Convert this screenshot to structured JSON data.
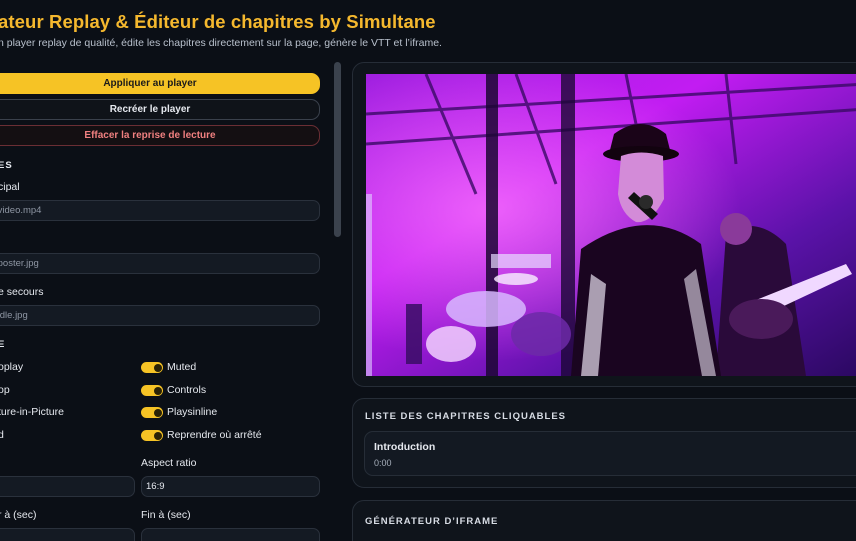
{
  "header": {
    "title": "ateur Replay & Éditeur de chapitres by Simultane",
    "subtitle": "n player replay de qualité, édite les chapitres directement sur la page, génère le VTT et l’iframe."
  },
  "actions": {
    "apply_label": "Appliquer au player",
    "recreate_label": "Recréer le player",
    "clear_label": "Effacer la reprise de lecture"
  },
  "sources": {
    "section_label": "ES",
    "main_label": "cipal",
    "main_placeholder": "/video.mp4",
    "poster_placeholder": "/poster.jpg",
    "fallback_label": "e secours",
    "fallback_placeholder": "/idle.jpg"
  },
  "options": {
    "section_label": "E",
    "toggles_left": [
      "oplay",
      "op",
      "ture-in-Picture",
      "d"
    ],
    "toggles_right": [
      "Muted",
      "Controls",
      "Playsinline",
      "Reprendre où arrêté"
    ]
  },
  "timing": {
    "aspect_label": "Aspect ratio",
    "aspect_value": "16:9",
    "start_label": "r à (sec)",
    "end_label": "Fin à (sec)"
  },
  "chapters": {
    "title": "LISTE DES CHAPITRES CLIQUABLES",
    "items": [
      {
        "name": "Introduction",
        "time": "0:00"
      }
    ]
  },
  "iframe": {
    "title": "GÉNÉRATEUR D’IFRAME"
  },
  "colors": {
    "accent": "#f6c325",
    "title": "#f5b82e",
    "danger": "#f08080",
    "background": "#0b0f16"
  }
}
